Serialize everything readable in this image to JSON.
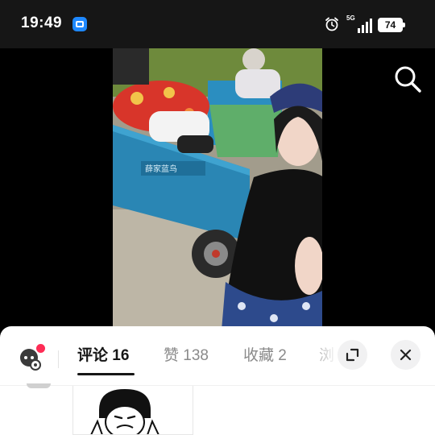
{
  "status_bar": {
    "time": "19:49",
    "network": "5G",
    "battery": "74"
  },
  "video": {
    "description": "",
    "search_icon": "search-icon"
  },
  "comments_panel": {
    "tabs": [
      {
        "label": "评论 16",
        "active": true
      },
      {
        "label": "赞 138",
        "active": false
      },
      {
        "label": "收藏 2",
        "active": false
      },
      {
        "label": "浏",
        "active": false
      }
    ],
    "expand_icon": "expand-icon",
    "close_icon": "close-icon"
  },
  "colors": {
    "accent": "#fe2c55",
    "status_bg": "#161616",
    "sheet_bg": "#ffffff"
  }
}
